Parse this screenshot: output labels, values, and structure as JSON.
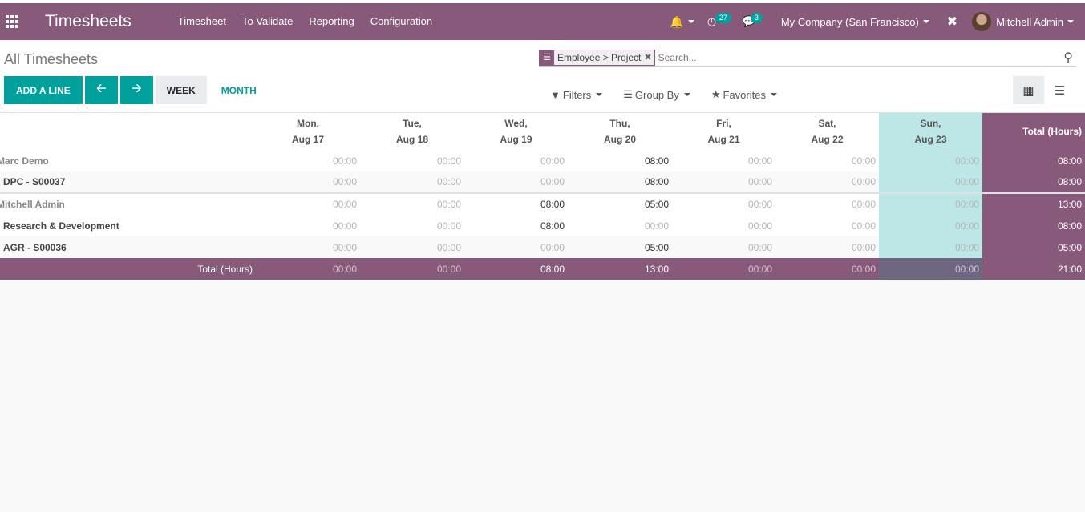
{
  "navbar": {
    "brand": "Timesheets",
    "menu": [
      "Timesheet",
      "To Validate",
      "Reporting",
      "Configuration"
    ],
    "activity_badge": "27",
    "message_badge": "3",
    "company": "My Company (San Francisco)",
    "user": "Mitchell Admin",
    "bg_color": "#875a7b"
  },
  "control": {
    "breadcrumb": "All Timesheets",
    "add_line": "ADD A LINE",
    "week": "WEEK",
    "month": "MONTH",
    "search_facet": "Employee > Project",
    "search_placeholder": "Search...",
    "filters": "Filters",
    "group_by": "Group By",
    "favorites": "Favorites"
  },
  "grid": {
    "headers": [
      {
        "day": "Mon,",
        "date": "Aug 17"
      },
      {
        "day": "Tue,",
        "date": "Aug 18"
      },
      {
        "day": "Wed,",
        "date": "Aug 19"
      },
      {
        "day": "Thu,",
        "date": "Aug 20"
      },
      {
        "day": "Fri,",
        "date": "Aug 21"
      },
      {
        "day": "Sat,",
        "date": "Aug 22"
      },
      {
        "day": "Sun,",
        "date": "Aug 23"
      }
    ],
    "total_header": "Total (Hours)",
    "rows": [
      {
        "label": "Marc Demo",
        "type": "group",
        "values": [
          "00:00",
          "00:00",
          "00:00",
          "08:00",
          "00:00",
          "00:00",
          "00:00"
        ],
        "total": "08:00"
      },
      {
        "label": "DPC - S00037",
        "type": "line",
        "values": [
          "00:00",
          "00:00",
          "00:00",
          "08:00",
          "00:00",
          "00:00",
          "00:00"
        ],
        "total": "08:00"
      },
      {
        "label": "Mitchell Admin",
        "type": "group",
        "values": [
          "00:00",
          "00:00",
          "08:00",
          "05:00",
          "00:00",
          "00:00",
          "00:00"
        ],
        "total": "13:00"
      },
      {
        "label": "Research & Development",
        "type": "line",
        "values": [
          "00:00",
          "00:00",
          "08:00",
          "00:00",
          "00:00",
          "00:00",
          "00:00"
        ],
        "total": "08:00"
      },
      {
        "label": "AGR - S00036",
        "type": "line",
        "values": [
          "00:00",
          "00:00",
          "00:00",
          "05:00",
          "00:00",
          "00:00",
          "00:00"
        ],
        "total": "05:00"
      }
    ],
    "footer": {
      "label": "Total (Hours)",
      "values": [
        "00:00",
        "00:00",
        "08:00",
        "13:00",
        "00:00",
        "00:00",
        "00:00"
      ],
      "total": "21:00"
    }
  }
}
